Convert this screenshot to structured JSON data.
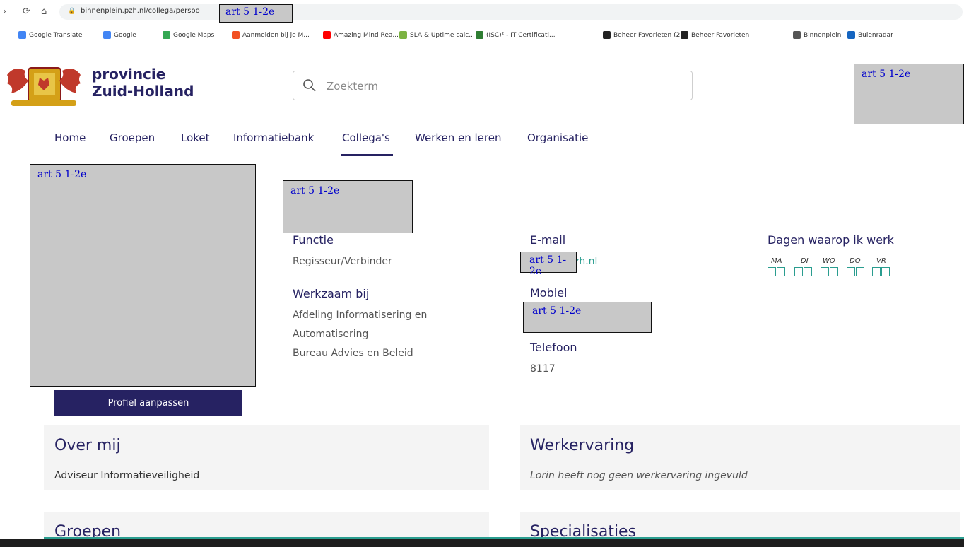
{
  "browser": {
    "url": "binnenplein.pzh.nl/collega/persoo",
    "url_redaction": "art 5 1-2e",
    "bookmarks": [
      {
        "label": "Google Translate",
        "icon": "translate-icon",
        "color": "#4285f4"
      },
      {
        "label": "Google",
        "icon": "google-icon",
        "color": "#4285f4"
      },
      {
        "label": "Google Maps",
        "icon": "maps-pin-icon",
        "color": "#34a853"
      },
      {
        "label": "Aanmelden bij je M...",
        "icon": "microsoft-icon",
        "color": "#f25022"
      },
      {
        "label": "Amazing Mind Rea...",
        "icon": "youtube-icon",
        "color": "#ff0000"
      },
      {
        "label": "SLA & Uptime calc...",
        "icon": "sla-icon",
        "color": "#7cb342"
      },
      {
        "label": "(ISC)² - IT Certificati...",
        "icon": "isc2-icon",
        "color": "#2e7d32"
      },
      {
        "label": "Beheer Favorieten (2)",
        "icon": "ot-icon",
        "color": "#222222"
      },
      {
        "label": "Beheer Favorieten",
        "icon": "ot-icon",
        "color": "#222222"
      },
      {
        "label": "Binnenplein",
        "icon": "globe-icon",
        "color": "#555555"
      },
      {
        "label": "Buienradar",
        "icon": "buienradar-icon",
        "color": "#1565c0"
      }
    ]
  },
  "header": {
    "brand_line1": "provincie",
    "brand_line2": "Zuid-Holland",
    "search_placeholder": "Zoekterm",
    "user_redaction": "art 5 1-2e"
  },
  "nav": {
    "items": [
      "Home",
      "Groepen",
      "Loket",
      "Informatiebank",
      "Collega's",
      "Werken en leren",
      "Organisatie"
    ],
    "active": "Collega's"
  },
  "profile": {
    "photo_redaction": "art 5 1-2e",
    "name_redaction": "art 5 1-2e",
    "functie_label": "Functie",
    "functie_value": "Regisseur/Verbinder",
    "werkzaam_label": "Werkzaam bij",
    "werkzaam_lines": [
      "Afdeling Informatisering en",
      "Automatisering",
      "Bureau Advies en Beleid"
    ],
    "email_label": "E-mail",
    "email_redaction": "art 5 1-2e",
    "email_suffix": "zh.nl",
    "mobiel_label": "Mobiel",
    "mobiel_redaction": "art 5 1-2e",
    "telefoon_label": "Telefoon",
    "telefoon_value": "8117",
    "dagen_label": "Dagen waarop ik werk",
    "days": [
      "MA",
      "DI",
      "WO",
      "DO",
      "VR"
    ],
    "edit_button": "Profiel aanpassen"
  },
  "sections": {
    "over_mij_title": "Over mij",
    "over_mij_text": "Adviseur Informatieveiligheid",
    "werkervaring_title": "Werkervaring",
    "werkervaring_text": "Lorin heeft nog geen werkervaring ingevuld",
    "groepen_title": "Groepen",
    "specialisaties_title": "Specialisaties"
  },
  "colors": {
    "brand": "#262262",
    "accent": "#2a9d8f",
    "redaction": "#c8c8c8"
  }
}
